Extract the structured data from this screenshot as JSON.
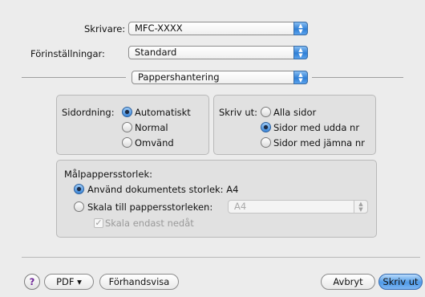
{
  "printer": {
    "label": "Skrivare:",
    "value": "MFC-XXXX"
  },
  "presets": {
    "label": "Förinställningar:",
    "value": "Standard"
  },
  "panel": {
    "value": "Pappershantering"
  },
  "page_order": {
    "label": "Sidordning:",
    "options": [
      "Automatiskt",
      "Normal",
      "Omvänd"
    ],
    "selected": "Automatiskt"
  },
  "print_pages": {
    "label": "Skriv ut:",
    "options": [
      "Alla sidor",
      "Sidor med udda nr",
      "Sidor med jämna nr"
    ],
    "selected": "Sidor med udda nr"
  },
  "destination_size": {
    "title": "Målpappersstorlek:",
    "use_document_size": "Använd dokumentets storlek: A4",
    "scale_to_paper": "Skala till pappersstorleken:",
    "paper_value": "A4",
    "scale_down_only": "Skala endast nedåt"
  },
  "buttons": {
    "help": "?",
    "pdf": "PDF ▾",
    "preview": "Förhandsvisa",
    "cancel": "Avbryt",
    "print": "Skriv ut"
  }
}
